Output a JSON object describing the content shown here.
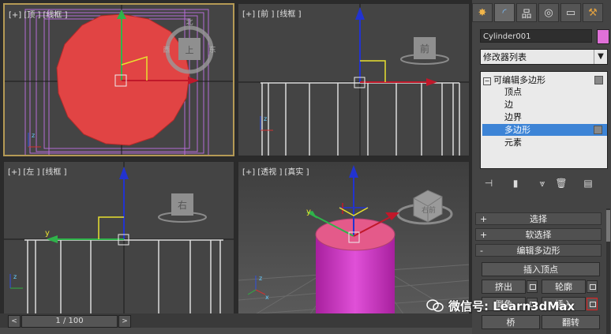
{
  "viewports": {
    "top": {
      "label": "[+] [顶 ] [线框 ]",
      "cube": "上",
      "compass": [
        "北",
        "西",
        "东"
      ]
    },
    "front": {
      "label": "[+] [前 ] [线框 ]",
      "cube": "前"
    },
    "left": {
      "label": "[+] [左 ] [线框 ]",
      "cube": "右"
    },
    "persp": {
      "label": "[+] [透视 ] [真实 ]",
      "cube": "右前"
    }
  },
  "axes": {
    "x": "x",
    "y": "y",
    "z": "z"
  },
  "command_panel": {
    "tabs": [
      {
        "icon": "create-icon",
        "glyph": "✸"
      },
      {
        "icon": "modify-icon",
        "glyph": "◜"
      },
      {
        "icon": "hierarchy-icon",
        "glyph": "品"
      },
      {
        "icon": "motion-icon",
        "glyph": "◎"
      },
      {
        "icon": "display-icon",
        "glyph": "▭"
      },
      {
        "icon": "utilities-icon",
        "glyph": "⚒"
      }
    ],
    "object_name": "Cylinder001",
    "object_color": "#e070d8",
    "modifier_list": "修改器列表",
    "stack": {
      "root": "可编辑多边形",
      "items": [
        "顶点",
        "边",
        "边界",
        "多边形",
        "元素"
      ],
      "selected": "多边形"
    },
    "stack_tools": [
      "pin-stack-icon",
      "show-end-result-icon",
      "make-unique-icon",
      "remove-modifier-icon",
      "configure-sets-icon"
    ],
    "rollouts": {
      "selection": {
        "sign": "+",
        "title": "选择"
      },
      "soft_selection": {
        "sign": "+",
        "title": "软选择"
      },
      "edit_polygons": {
        "sign": "-",
        "title": "编辑多边形"
      }
    },
    "buttons": {
      "insert_vertex": "插入顶点",
      "extrude": "挤出",
      "outline": "轮廓",
      "bevel": "倒角",
      "inset": "插入",
      "bridge": "桥",
      "flip": "翻转"
    }
  },
  "timeline": {
    "frame": "1 / 100",
    "prev": "<",
    "next": ">"
  },
  "watermark": {
    "text": "微信号: Learn3dMax"
  }
}
